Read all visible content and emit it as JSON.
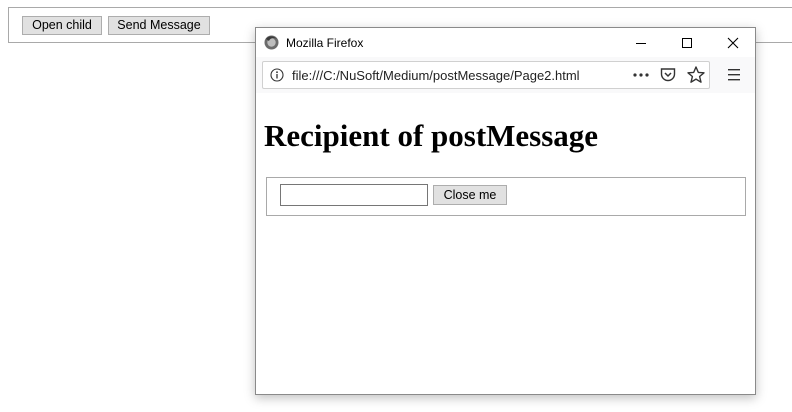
{
  "parent": {
    "open_child_label": "Open child",
    "send_message_label": "Send Message"
  },
  "popup": {
    "window_title": "Mozilla Firefox",
    "url": "file:///C:/NuSoft/Medium/postMessage/Page2.html",
    "heading": "Recipient of postMessage",
    "input_value": "",
    "close_label": "Close me",
    "titlebar_buttons": [
      "minimize-icon",
      "maximize-icon",
      "close-icon"
    ],
    "toolbar_icons": [
      "info-icon",
      "more-icon",
      "pocket-icon",
      "star-icon",
      "hamburger-menu-icon"
    ]
  },
  "colors": {
    "button_bg": "#e1e1e1",
    "button_border": "#adadad",
    "navbar_bg": "#f9f9fa",
    "fieldset_border": "#a9a9a9"
  }
}
